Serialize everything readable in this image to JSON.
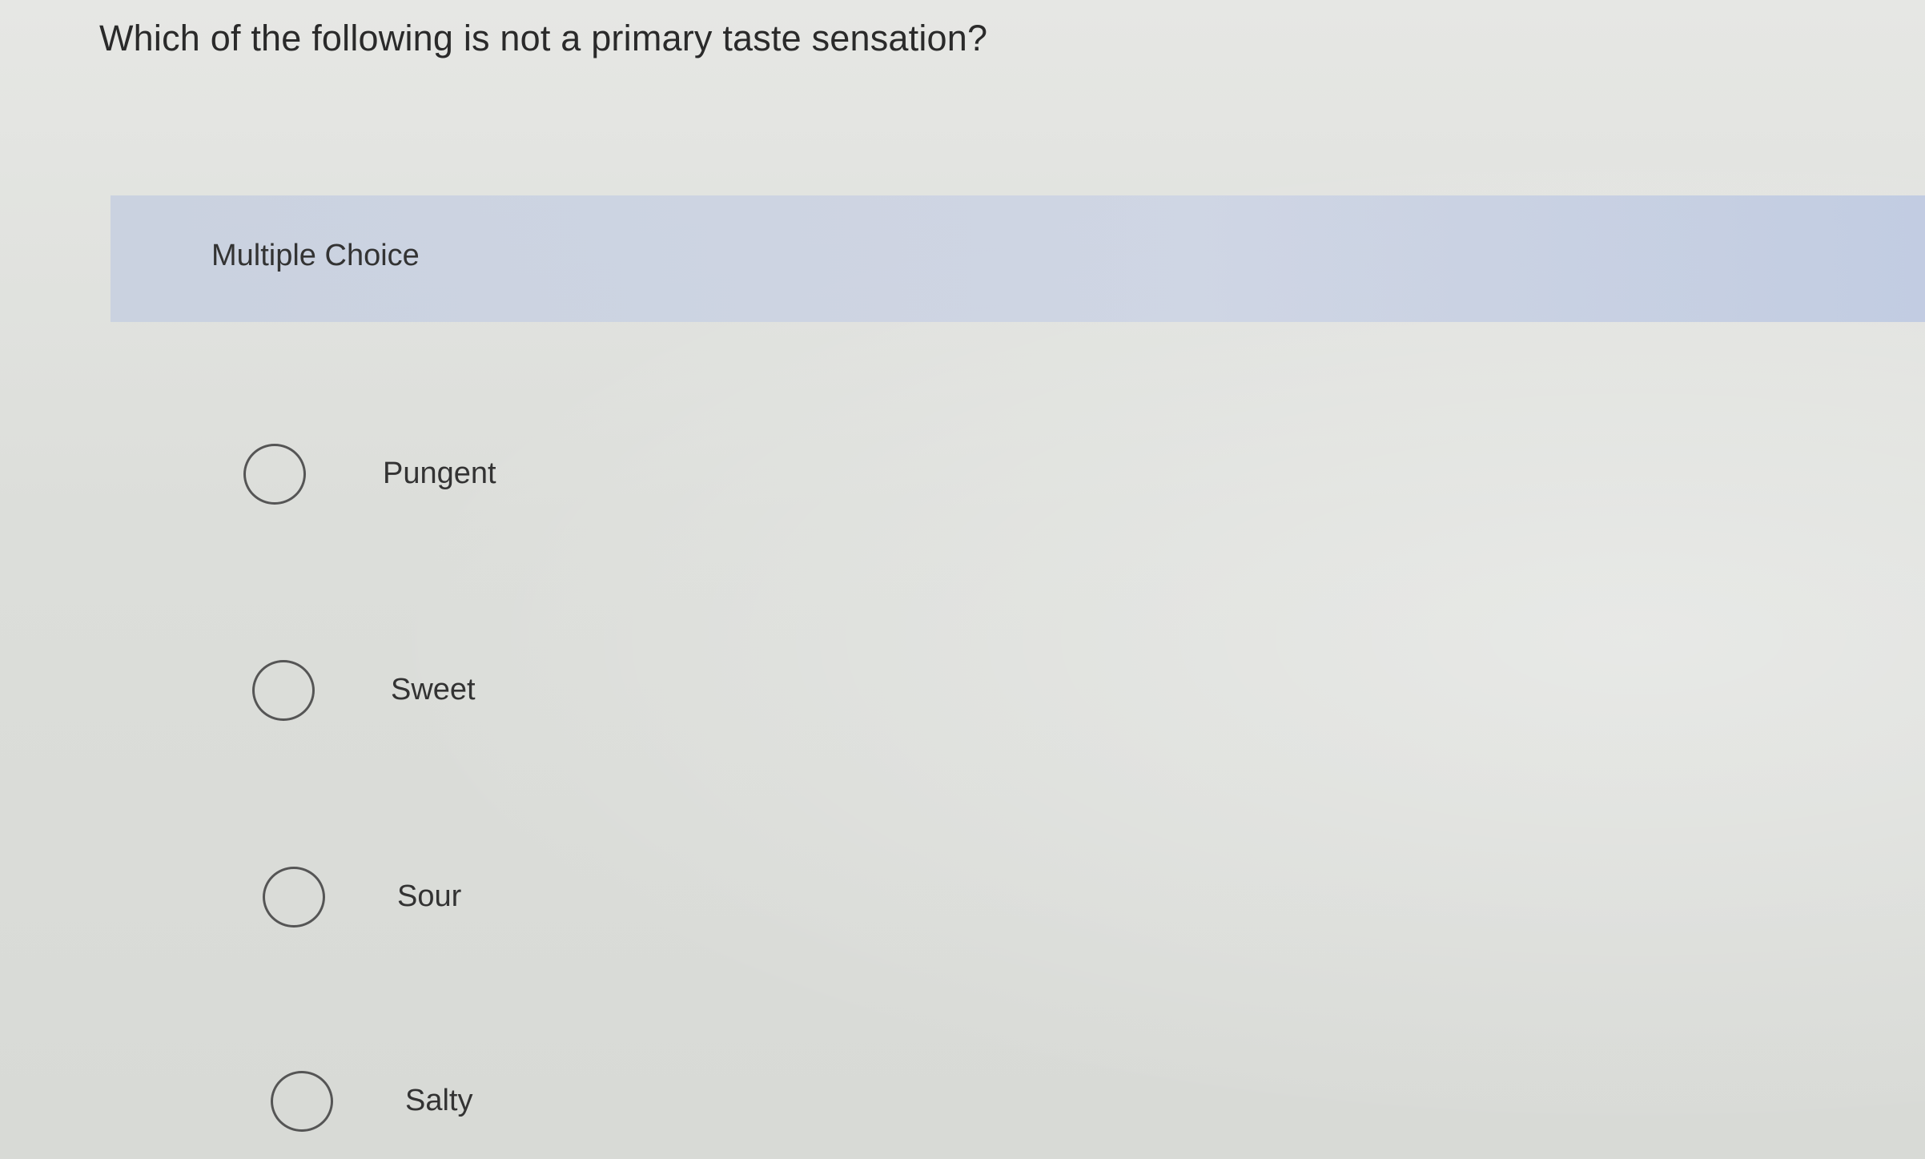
{
  "question": {
    "text": "Which of the following is not a primary taste sensation?"
  },
  "answer_section": {
    "header_label": "Multiple Choice",
    "options": [
      {
        "label": "Pungent",
        "selected": false
      },
      {
        "label": "Sweet",
        "selected": false
      },
      {
        "label": "Sour",
        "selected": false
      },
      {
        "label": "Salty",
        "selected": false
      }
    ]
  }
}
